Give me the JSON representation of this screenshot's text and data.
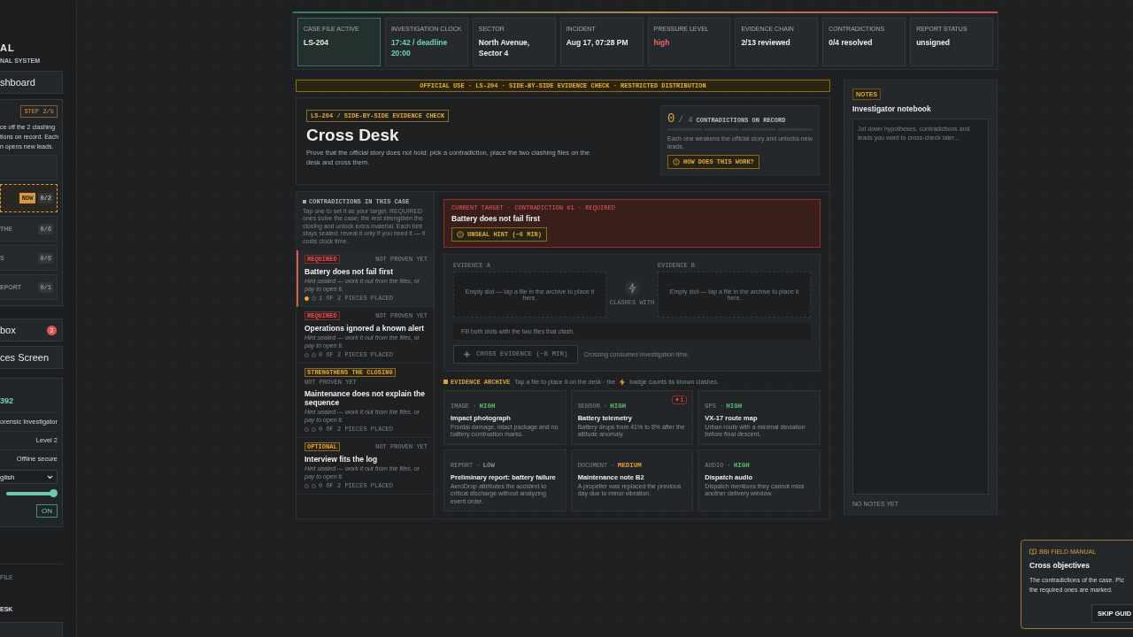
{
  "sidebar": {
    "title": "AL",
    "subtitle": "NAL SYSTEM",
    "dashboard": "shboard",
    "steps_panel": {
      "badge": "STEP 2/5",
      "lines": [
        "ce off the 2 clashing",
        "tions on record. Each",
        "n opens new leads."
      ],
      "steps": [
        {
          "selected": false
        },
        {
          "now": "NOW",
          "count": "0/2",
          "selected": true
        },
        {
          "label": "THE",
          "count": "0/6",
          "selected": false
        },
        {
          "label": "S",
          "count": "0/6",
          "selected": false
        },
        {
          "label": "EPORT",
          "count": "0/1",
          "selected": false
        }
      ]
    },
    "nav": [
      {
        "label": "box",
        "badge": "2"
      },
      {
        "label": "ces Screen"
      }
    ],
    "profile": {
      "id": "392",
      "rows": [
        "orensic Investigator",
        "Level 2",
        "Offline secure"
      ],
      "language": "glish",
      "volume": {
        "level": 0.93
      },
      "toggle": {
        "label": "ON",
        "on": true
      }
    },
    "footer": {
      "file": "FILE",
      "desk": "ESK"
    }
  },
  "stats": [
    {
      "label": "CASE FILE ACTIVE",
      "value": "LS-204",
      "color": "#eceef0",
      "selected": true
    },
    {
      "label": "INVESTIGATION CLOCK",
      "value": "17:42 / deadline 20:00",
      "color": "#6dd3b8",
      "selected": false
    },
    {
      "label": "SECTOR",
      "value": "North Avenue, Sector 4",
      "color": "#eceef0",
      "selected": false
    },
    {
      "label": "INCIDENT",
      "value": "Aug 17, 07:28 PM",
      "color": "#eceef0",
      "selected": false
    },
    {
      "label": "PRESSURE LEVEL",
      "value": "high",
      "color": "#f06565",
      "selected": false
    },
    {
      "label": "EVIDENCE CHAIN",
      "value": "2/13 reviewed",
      "color": "#eceef0",
      "selected": false
    },
    {
      "label": "CONTRADICTIONS",
      "value": "0/4 resolved",
      "color": "#eceef0",
      "selected": false
    },
    {
      "label": "REPORT STATUS",
      "value": "unsigned",
      "color": "#eceef0",
      "selected": false
    }
  ],
  "banner": "OFFICIAL USE · LS-204 · SIDE-BY-SIDE EVIDENCE CHECK · RESTRICTED DISTRIBUTION",
  "header": {
    "tag": "LS-204 / SIDE-BY-SIDE EVIDENCE CHECK",
    "title": "Cross Desk",
    "description": "Prove that the official story does not hold: pick a contradiction, place the two clashing files on the desk and cross them.",
    "record": {
      "count": "0",
      "total": "/ 4",
      "label": "CONTRADICTIONS ON RECORD",
      "segments": [
        {
          "filled": false
        },
        {
          "filled": false
        },
        {
          "filled": false
        },
        {
          "filled": false
        }
      ],
      "note": "Each one weakens the official story and unlocks new leads.",
      "button": "HOW DOES THIS WORK?"
    }
  },
  "contradictions": {
    "title": "CONTRADICTIONS IN THIS CASE",
    "intro": "Tap one to set it as your target. REQUIRED ones solve the case; the rest strengthen the closing and unlock extra material. Each hint stays sealed: reveal it only if you need it — it costs clock time.",
    "items": [
      {
        "tag": "REQUIRED",
        "kind": "required",
        "status": "NOT PROVEN YET",
        "title": "Battery does not fail first",
        "hint": "Hint sealed — work it out from the files, or pay to open it.",
        "progress": "1 OF 2 PIECES PLACED",
        "dots": [
          {
            "filled": true
          },
          {
            "filled": false
          }
        ],
        "selected": true
      },
      {
        "tag": "REQUIRED",
        "kind": "required",
        "status": "NOT PROVEN YET",
        "title": "Operations ignored a known alert",
        "hint": "Hint sealed — work it out from the files, or pay to open it.",
        "progress": "0 OF 2 PIECES PLACED",
        "dots": [
          {
            "filled": false
          },
          {
            "filled": false
          }
        ],
        "selected": false
      },
      {
        "tag": "STRENGTHENS THE CLOSING",
        "kind": "bonus",
        "status": "NOT PROVEN YET",
        "title": "Maintenance does not explain the sequence",
        "hint": "Hint sealed — work it out from the files, or pay to open it.",
        "progress": "0 OF 2 PIECES PLACED",
        "dots": [
          {
            "filled": false
          },
          {
            "filled": false
          }
        ],
        "selected": false
      },
      {
        "tag": "OPTIONAL",
        "kind": "bonus",
        "status": "NOT PROVEN YET",
        "title": "Interview fits the log",
        "hint": "Hint sealed — work it out from the files, or pay to open it.",
        "progress": "0 OF 2 PIECES PLACED",
        "dots": [
          {
            "filled": false
          },
          {
            "filled": false
          }
        ],
        "selected": false
      }
    ]
  },
  "target": {
    "label": "CURRENT TARGET · CONTRADICTION #1 · REQUIRED",
    "title": "Battery does not fail first",
    "button": "UNSEAL HINT (−6 MIN)"
  },
  "desk": {
    "slots": [
      {
        "label": "EVIDENCE A",
        "placeholder": "Empty slot — tap a file in the archive to place it here."
      },
      {
        "label": "EVIDENCE B",
        "placeholder": "Empty slot — tap a file in the archive to place it here."
      }
    ],
    "clash_label": "CLASHES WITH",
    "status": "Fill both slots with the two files that clash.",
    "button": {
      "label": "CROSS EVIDENCE (−8 MIN)",
      "disabled": true
    },
    "note": "Crossing consumes investigation time."
  },
  "archive": {
    "title": "EVIDENCE ARCHIVE",
    "hint_before": "Tap a file to place it on the desk · the",
    "hint_after": "badge counts its known clashes.",
    "files": [
      {
        "type": "IMAGE ·",
        "reliability": "HIGH",
        "color": "#5cb86e",
        "title": "Impact photograph",
        "description": "Frontal damage, intact package and no battery combustion marks."
      },
      {
        "type": "SENSOR ·",
        "reliability": "HIGH",
        "color": "#5cb86e",
        "title": "Battery telemetry",
        "description": "Battery drops from 41% to 8% after the altitude anomaly.",
        "clashes": "1"
      },
      {
        "type": "GPS ·",
        "reliability": "HIGH",
        "color": "#5cb86e",
        "title": "VX-17 route map",
        "description": "Urban route with a minimal deviation before final descent."
      },
      {
        "type": "REPORT ·",
        "reliability": "LOW",
        "color": "#8a9096",
        "title": "Preliminary report: battery failure",
        "description": "AeroDrop attributes the accident to critical discharge without analyzing event order."
      },
      {
        "type": "DOCUMENT ·",
        "reliability": "MEDIUM",
        "color": "#e09a30",
        "title": "Maintenance note B2",
        "description": "A propeller was replaced the previous day due to minor vibration."
      },
      {
        "type": "AUDIO ·",
        "reliability": "HIGH",
        "color": "#5cb86e",
        "title": "Dispatch audio",
        "description": "Dispatch mentions they cannot miss another delivery window."
      }
    ]
  },
  "notes": {
    "tag": "NOTES",
    "title": "Investigator notebook",
    "placeholder": "Jot down hypotheses, contradictions and leads you want to cross-check later...",
    "status": "NO NOTES YET"
  },
  "guide": {
    "label": "BBI FIELD MANUAL",
    "title": "Cross objectives",
    "lines": [
      "The contradictions of the case. Pic",
      "the required ones are marked."
    ],
    "button": "SKIP GUID"
  }
}
